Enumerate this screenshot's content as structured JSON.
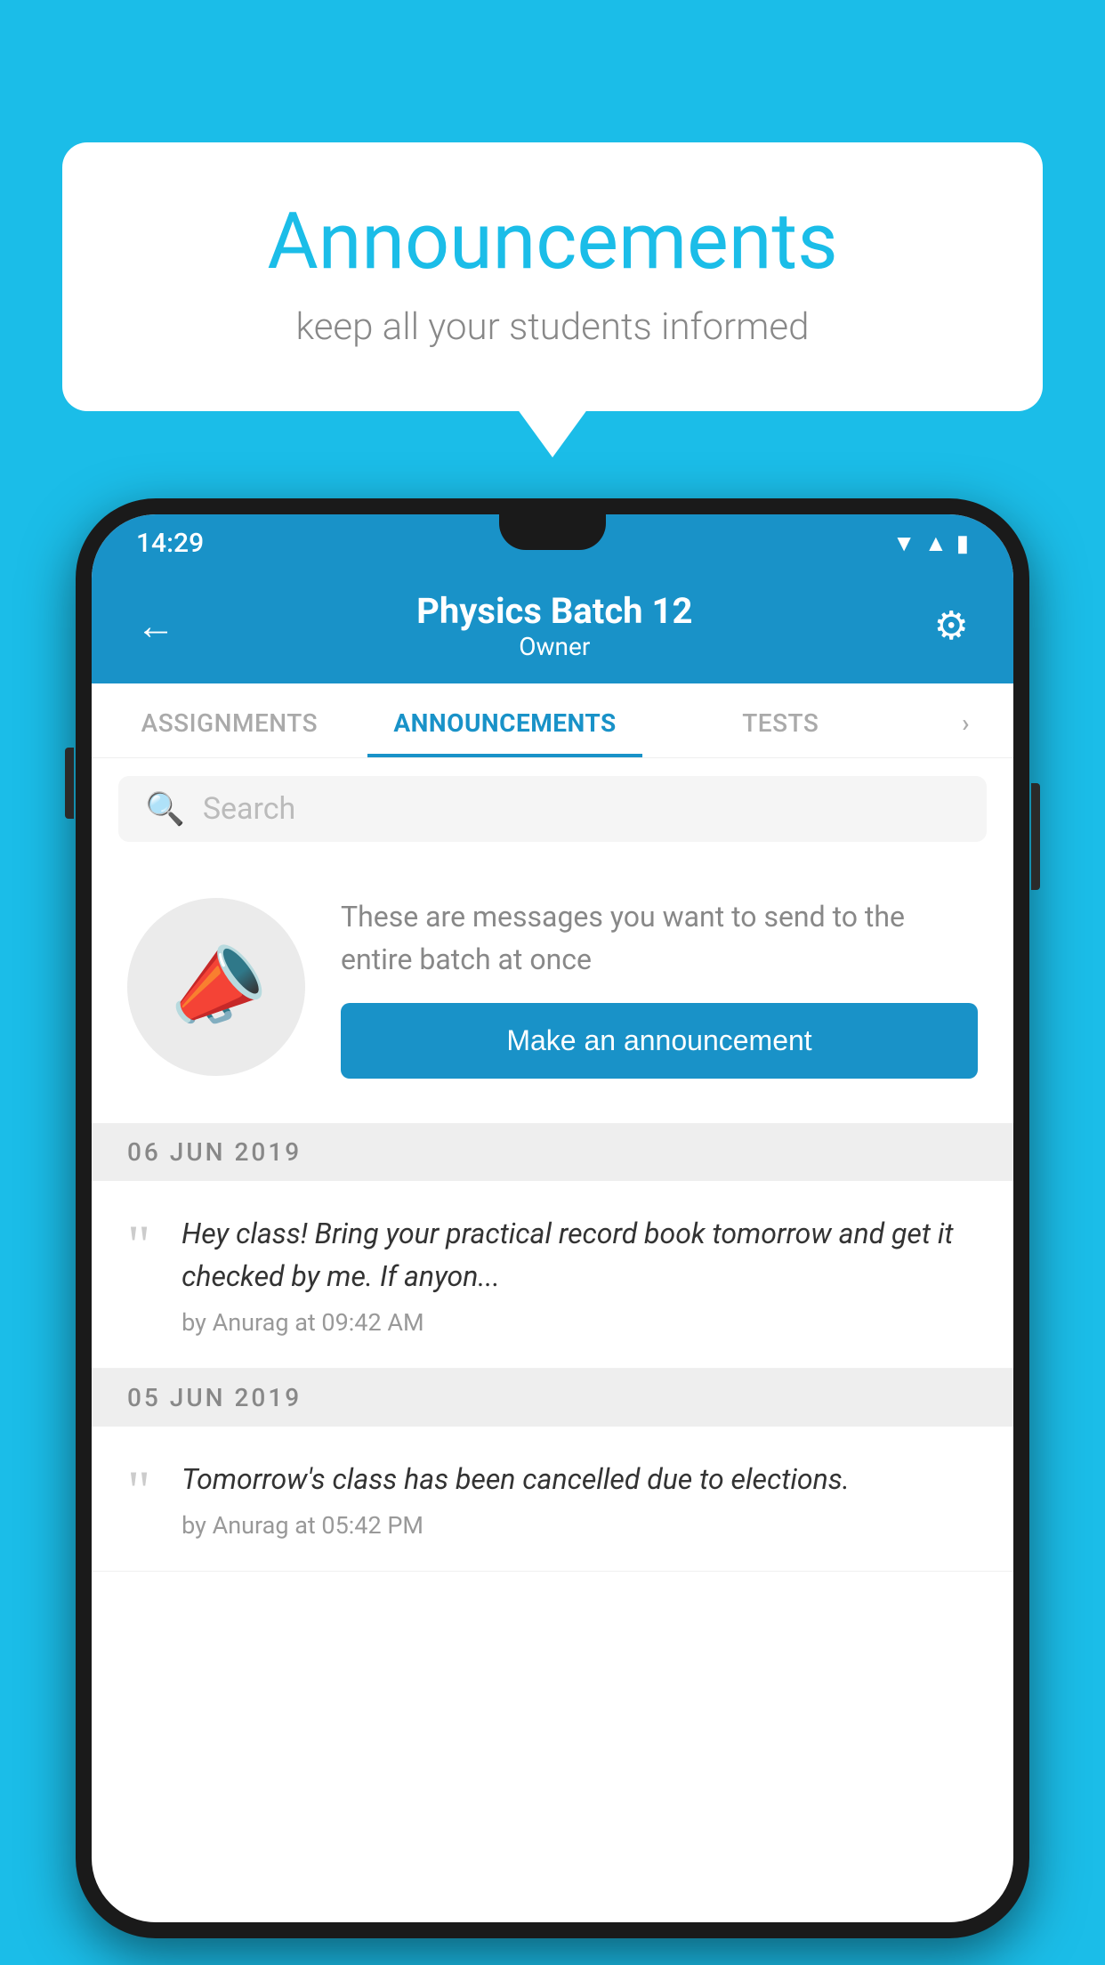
{
  "background_color": "#1BBDE8",
  "speech_bubble": {
    "title": "Announcements",
    "subtitle": "keep all your students informed"
  },
  "phone": {
    "status_bar": {
      "time": "14:29",
      "wifi_icon": "▲",
      "signal_icon": "▲",
      "battery_icon": "▮"
    },
    "header": {
      "back_label": "←",
      "title": "Physics Batch 12",
      "subtitle": "Owner",
      "gear_label": "⚙"
    },
    "tabs": [
      {
        "label": "ASSIGNMENTS",
        "active": false
      },
      {
        "label": "ANNOUNCEMENTS",
        "active": true
      },
      {
        "label": "TESTS",
        "active": false
      },
      {
        "label": "...",
        "active": false
      }
    ],
    "search": {
      "placeholder": "Search"
    },
    "empty_state": {
      "description": "These are messages you want to send to the entire batch at once",
      "button_label": "Make an announcement"
    },
    "announcements": [
      {
        "date": "06  JUN  2019",
        "text": "Hey class! Bring your practical record book tomorrow and get it checked by me. If anyon...",
        "meta": "by Anurag at 09:42 AM"
      },
      {
        "date": "05  JUN  2019",
        "text": "Tomorrow's class has been cancelled due to elections.",
        "meta": "by Anurag at 05:42 PM"
      }
    ]
  }
}
